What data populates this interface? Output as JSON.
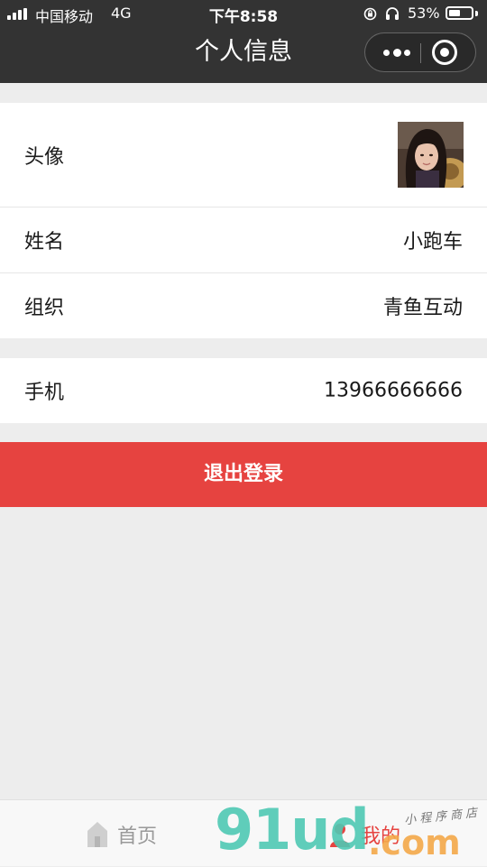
{
  "status_bar": {
    "carrier": "中国移动",
    "network": "4G",
    "time": "下午8:58",
    "battery": "53%",
    "battery_level": 0.53
  },
  "nav": {
    "title": "个人信息"
  },
  "profile": {
    "avatar_label": "头像",
    "name_label": "姓名",
    "name_value": "小跑车",
    "org_label": "组织",
    "org_value": "青鱼互动"
  },
  "contact": {
    "phone_label": "手机",
    "phone_value": "13966666666"
  },
  "logout_label": "退出登录",
  "tabbar": {
    "tabs": [
      {
        "label": "首页",
        "icon": "home-icon",
        "active": false
      },
      {
        "label": "我的",
        "icon": "user-icon",
        "active": true
      }
    ],
    "active_color": "#e64340",
    "inactive_color": "#999999"
  },
  "watermark": {
    "brand": "91ud",
    "domain": ".com",
    "script": "小程序商店"
  },
  "colors": {
    "nav_bg": "#333333",
    "page_bg": "#ededed",
    "logout_bg": "#e64340"
  }
}
